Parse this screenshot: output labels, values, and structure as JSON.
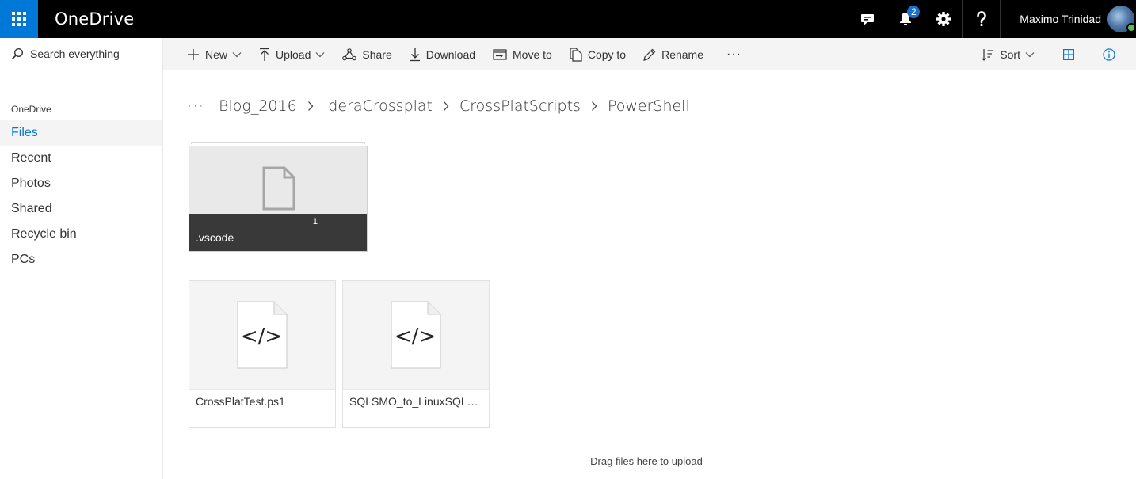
{
  "app": {
    "brand": "OneDrive",
    "notifications_count": "2",
    "user_name": "Maximo Trinidad"
  },
  "search": {
    "label": "Search everything"
  },
  "nav": {
    "section": "OneDrive",
    "items": [
      "Files",
      "Recent",
      "Photos",
      "Shared",
      "Recycle bin",
      "PCs"
    ],
    "active": "Files"
  },
  "commands": {
    "new": "New",
    "upload": "Upload",
    "share": "Share",
    "download": "Download",
    "move_to": "Move to",
    "copy_to": "Copy to",
    "rename": "Rename",
    "more": "···",
    "sort": "Sort"
  },
  "breadcrumb": {
    "more": "···",
    "items": [
      "Blog_2016",
      "IderaCrossplat",
      "CrossPlatScripts",
      "PowerShell"
    ]
  },
  "folders": [
    {
      "name": ".vscode",
      "count": "1"
    }
  ],
  "files": [
    {
      "name": "CrossPlatTest.ps1",
      "icon": "code-file-icon"
    },
    {
      "name": "SQLSMO_to_LinuxSQLS...",
      "icon": "code-file-icon"
    }
  ],
  "dropzone": {
    "text": "Drag files here to upload"
  },
  "colors": {
    "accent": "#0078d7",
    "topbar": "#000000",
    "commandbar": "#f4f4f4",
    "folder_label": "#393939"
  }
}
